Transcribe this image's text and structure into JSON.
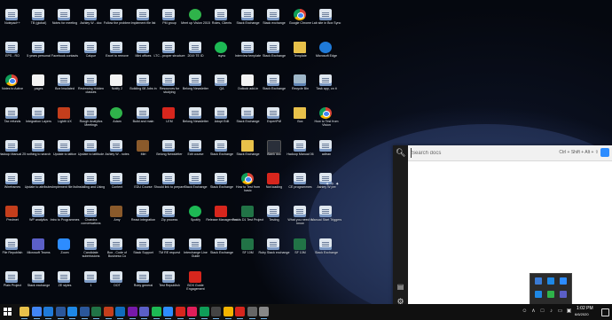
{
  "launcher": {
    "search_placeholder": "Search docs",
    "shortcut_hint": "Ctrl + Shift + Alt + ⇧"
  },
  "taskbar": {
    "clock_time": "1:02 PM",
    "clock_date": "6/6/2020"
  },
  "desktop_icons": [
    {
      "label": "Notepad++",
      "icon": "page"
    },
    {
      "label": "TB (global)",
      "icon": "page"
    },
    {
      "label": "Notes for meeting",
      "icon": "page"
    },
    {
      "label": "Ashley W - doc",
      "icon": "page"
    },
    {
      "label": "Follow the problem",
      "icon": "page"
    },
    {
      "label": "Implement file list",
      "icon": "page"
    },
    {
      "label": "PM group",
      "icon": "page"
    },
    {
      "label": "Meet up Vision 2015",
      "icon": "green"
    },
    {
      "label": "Roles, Clients",
      "icon": "page"
    },
    {
      "label": "Stack Exchange",
      "icon": "page"
    },
    {
      "label": "Stack exchange",
      "icon": "page"
    },
    {
      "label": "Google Chrome",
      "icon": "chrome"
    },
    {
      "label": "Lab site in Box Sync",
      "icon": "page"
    },
    {
      "label": "EPS - RO",
      "icon": "page"
    },
    {
      "label": "5 years personal",
      "icon": "page"
    },
    {
      "label": "Facebook contacts",
      "icon": "page"
    },
    {
      "label": "Calque",
      "icon": "page"
    },
    {
      "label": "Excel to remove",
      "icon": "page"
    },
    {
      "label": "Mini offices",
      "icon": "page"
    },
    {
      "label": "LTC - proper structure",
      "icon": "page"
    },
    {
      "label": "2019 TE ID",
      "icon": "page"
    },
    {
      "label": "rsync",
      "icon": "spotify"
    },
    {
      "label": "Interview template",
      "icon": "page"
    },
    {
      "label": "Stack Exchange",
      "icon": "page"
    },
    {
      "label": "Template",
      "icon": "folder"
    },
    {
      "label": "Microsoft Edge",
      "icon": "edge"
    },
    {
      "label": "Notes to Active",
      "icon": "chrome"
    },
    {
      "label": "pages",
      "icon": "white"
    },
    {
      "label": "Box Insulated",
      "icon": "page"
    },
    {
      "label": "Reviewing Hidden classes",
      "icon": "page"
    },
    {
      "label": "Notify 2",
      "icon": "white"
    },
    {
      "label": "Building 08 Jobs in",
      "icon": "page"
    },
    {
      "label": "Resources for studying",
      "icon": "page"
    },
    {
      "label": "Belong Newsletter",
      "icon": "page"
    },
    {
      "label": "QA",
      "icon": "page"
    },
    {
      "label": "Outlook add-in",
      "icon": "white"
    },
    {
      "label": "Stack Exchange",
      "icon": "page"
    },
    {
      "label": "Recycle Bin",
      "icon": "recycle"
    },
    {
      "label": "Task app, on it",
      "icon": "page"
    },
    {
      "label": "Tax refunds",
      "icon": "page"
    },
    {
      "label": "Integration Layers",
      "icon": "page"
    },
    {
      "label": "Lightit UX",
      "icon": "ppt"
    },
    {
      "label": "Rough Analytics Meetings",
      "icon": "page"
    },
    {
      "label": "Adam",
      "icon": "green"
    },
    {
      "label": "Build and main",
      "icon": "page"
    },
    {
      "label": "LEM",
      "icon": "pdf"
    },
    {
      "label": "Belong Newsletter",
      "icon": "page"
    },
    {
      "label": "Adopt Edit",
      "icon": "page"
    },
    {
      "label": "Stack Exchange",
      "icon": "page"
    },
    {
      "label": "ExpertPdf",
      "icon": "page"
    },
    {
      "label": "Box",
      "icon": "folder"
    },
    {
      "label": "How to Test from Vision",
      "icon": "chrome"
    },
    {
      "label": "Hadoop Manual 25",
      "icon": "page"
    },
    {
      "label": "nothing to search",
      "icon": "page"
    },
    {
      "label": "Update to lattice",
      "icon": "page"
    },
    {
      "label": "Update to lattitude",
      "icon": "page"
    },
    {
      "label": "Ashley W - notes",
      "icon": "page"
    },
    {
      "label": "Miri",
      "icon": "brown"
    },
    {
      "label": "Belong Newsletter",
      "icon": "page"
    },
    {
      "label": "Edit course",
      "icon": "page"
    },
    {
      "label": "Stack Exchange",
      "icon": "page"
    },
    {
      "label": "Stack Exchange",
      "icon": "folder"
    },
    {
      "label": "Blank doc",
      "icon": "dark"
    },
    {
      "label": "Hadoop Manual 06",
      "icon": "page"
    },
    {
      "label": "adtran",
      "icon": "page"
    },
    {
      "label": "Wireframes",
      "icon": "page"
    },
    {
      "label": "Update to attributes",
      "icon": "page"
    },
    {
      "label": "Implement file list",
      "icon": "page"
    },
    {
      "label": "Installing and Using",
      "icon": "page"
    },
    {
      "label": "Content",
      "icon": "page"
    },
    {
      "label": "EDU Course",
      "icon": "page"
    },
    {
      "label": "Should link to prepare",
      "icon": "page"
    },
    {
      "label": "Stack Exchange",
      "icon": "page"
    },
    {
      "label": "Stack Exchange",
      "icon": "page"
    },
    {
      "label": "How to Test from basic",
      "icon": "chrome"
    },
    {
      "label": "Not loading",
      "icon": "pdf"
    },
    {
      "label": "CE programmes",
      "icon": "page"
    },
    {
      "label": "Ashley W pre",
      "icon": "page"
    },
    {
      "label": "Predmet",
      "icon": "ppt"
    },
    {
      "label": "WP analytics",
      "icon": "page"
    },
    {
      "label": "Intro to Programmes",
      "icon": "page"
    },
    {
      "label": "Chandra conversations",
      "icon": "page"
    },
    {
      "label": "Amy",
      "icon": "brown"
    },
    {
      "label": "React integration",
      "icon": "page"
    },
    {
      "label": "Zip process",
      "icon": "page"
    },
    {
      "label": "Spotify",
      "icon": "spotify"
    },
    {
      "label": "Release Management",
      "icon": "pdf"
    },
    {
      "label": "Foods D1 Test Project",
      "icon": "excel"
    },
    {
      "label": "Testing",
      "icon": "page"
    },
    {
      "label": "What you need to know",
      "icon": "page"
    },
    {
      "label": "Manual Start Triggers",
      "icon": "page"
    },
    {
      "label": "File Republish",
      "icon": "page"
    },
    {
      "label": "Microsoft Teams",
      "icon": "teams"
    },
    {
      "label": "Zoom",
      "icon": "zoom"
    },
    {
      "label": "Candidate submissions",
      "icon": "page"
    },
    {
      "label": "Box - Code of Business Co",
      "icon": "page"
    },
    {
      "label": "Stack Support",
      "icon": "page"
    },
    {
      "label": "TM RE request",
      "icon": "page"
    },
    {
      "label": "Interchange Line Guide",
      "icon": "page"
    },
    {
      "label": "Stack Exchange",
      "icon": "page"
    },
    {
      "label": "SF 10M",
      "icon": "excel"
    },
    {
      "label": "Ruby Stack exchange",
      "icon": "page"
    },
    {
      "label": "SF 10M",
      "icon": "excel"
    },
    {
      "label": "Stack Exchange",
      "icon": "page"
    },
    {
      "label": "Plain Project",
      "icon": "page"
    },
    {
      "label": "Stack exchange",
      "icon": "page"
    },
    {
      "label": "ZE styles",
      "icon": "page"
    },
    {
      "label": "1",
      "icon": "page"
    },
    {
      "label": "DOT",
      "icon": "page"
    },
    {
      "label": "Ruby general",
      "icon": "page"
    },
    {
      "label": "Test Republish",
      "icon": "page"
    },
    {
      "label": "BOX Guide Engagement",
      "icon": "pdf"
    }
  ],
  "taskbar_apps": [
    {
      "icon": "file-explorer-icon",
      "color": "#e8c14a"
    },
    {
      "icon": "chrome-icon",
      "color": "#4285f4"
    },
    {
      "icon": "edge-icon",
      "color": "#1f7ad8"
    },
    {
      "icon": "store-icon",
      "color": "#2b579a"
    },
    {
      "icon": "mail-icon",
      "color": "#1e88e5"
    },
    {
      "icon": "word-icon",
      "color": "#2b579a"
    },
    {
      "icon": "excel-icon",
      "color": "#217346"
    },
    {
      "icon": "powerpoint-icon",
      "color": "#c43e1c"
    },
    {
      "icon": "outlook-icon",
      "color": "#0f6cbd"
    },
    {
      "icon": "onenote-icon",
      "color": "#7719aa"
    },
    {
      "icon": "teams-icon",
      "color": "#5b5fc7"
    },
    {
      "icon": "spotify-icon",
      "color": "#1db954"
    },
    {
      "icon": "zoom-icon",
      "color": "#2d8cff"
    },
    {
      "icon": "photos-icon",
      "color": "#d7261d"
    },
    {
      "icon": "slack-icon",
      "color": "#e01e5a"
    },
    {
      "icon": "vscode-icon",
      "color": "#0f9d58"
    },
    {
      "icon": "terminal-icon",
      "color": "#444444"
    },
    {
      "icon": "paint-icon",
      "color": "#f4b400"
    },
    {
      "icon": "acrobat-icon",
      "color": "#d7261d"
    },
    {
      "icon": "calculator-icon",
      "color": "#666666"
    },
    {
      "icon": "settings-icon",
      "color": "#888888"
    }
  ],
  "tray_flyout_icons": [
    {
      "icon": "defender-icon",
      "color": "#3a7bd5"
    },
    {
      "icon": "network-icon",
      "color": "#1e88e5"
    },
    {
      "icon": "onedrive-icon",
      "color": "#2d8cff"
    },
    {
      "icon": "bluetooth-icon",
      "color": "#1e88e5"
    },
    {
      "icon": "sync-icon",
      "color": "#2fb34a"
    },
    {
      "icon": "display-icon",
      "color": "#5b5fc7"
    }
  ]
}
